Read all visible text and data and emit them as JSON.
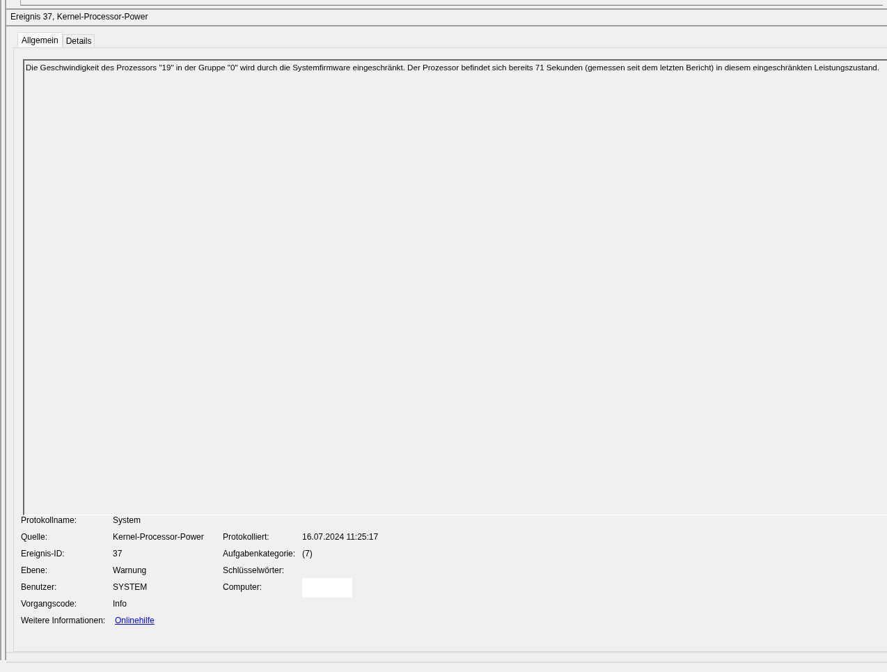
{
  "window": {
    "title": "Ereignis 37, Kernel-Processor-Power"
  },
  "tabs": [
    {
      "label": "Allgemein",
      "selected": true
    },
    {
      "label": "Details",
      "selected": false
    }
  ],
  "message": "Die Geschwindigkeit des Prozessors \"19\" in der Gruppe \"0\" wird durch die Systemfirmware eingeschränkt. Der Prozessor befindet sich bereits 71 Sekunden (gemessen seit dem letzten Bericht) in diesem eingeschränkten Leistungszustand.",
  "rows": [
    {
      "left": {
        "label": "Protokollname:",
        "value": "System",
        "kind": "text"
      }
    },
    {
      "left": {
        "label": "Quelle:",
        "value": "Kernel-Processor-Power",
        "kind": "text"
      },
      "right": {
        "label": "Protokolliert:",
        "value": "16.07.2024 11:25:17",
        "kind": "text"
      }
    },
    {
      "left": {
        "label": "Ereignis-ID:",
        "value": "37",
        "kind": "text"
      },
      "right": {
        "label": "Aufgabenkategorie:",
        "value": "(7)",
        "kind": "text"
      }
    },
    {
      "left": {
        "label": "Ebene:",
        "value": "Warnung",
        "kind": "text"
      },
      "right": {
        "label": "Schlüsselwörter:",
        "kind": "empty"
      }
    },
    {
      "left": {
        "label": "Benutzer:",
        "value": "SYSTEM",
        "kind": "text"
      },
      "right": {
        "label": "Computer:",
        "kind": "redacted"
      }
    },
    {
      "left": {
        "label": "Vorgangscode:",
        "value": "Info",
        "kind": "text"
      }
    },
    {
      "left": {
        "label": "Weitere Informationen:",
        "value": "Onlinehilfe",
        "kind": "link"
      }
    }
  ]
}
